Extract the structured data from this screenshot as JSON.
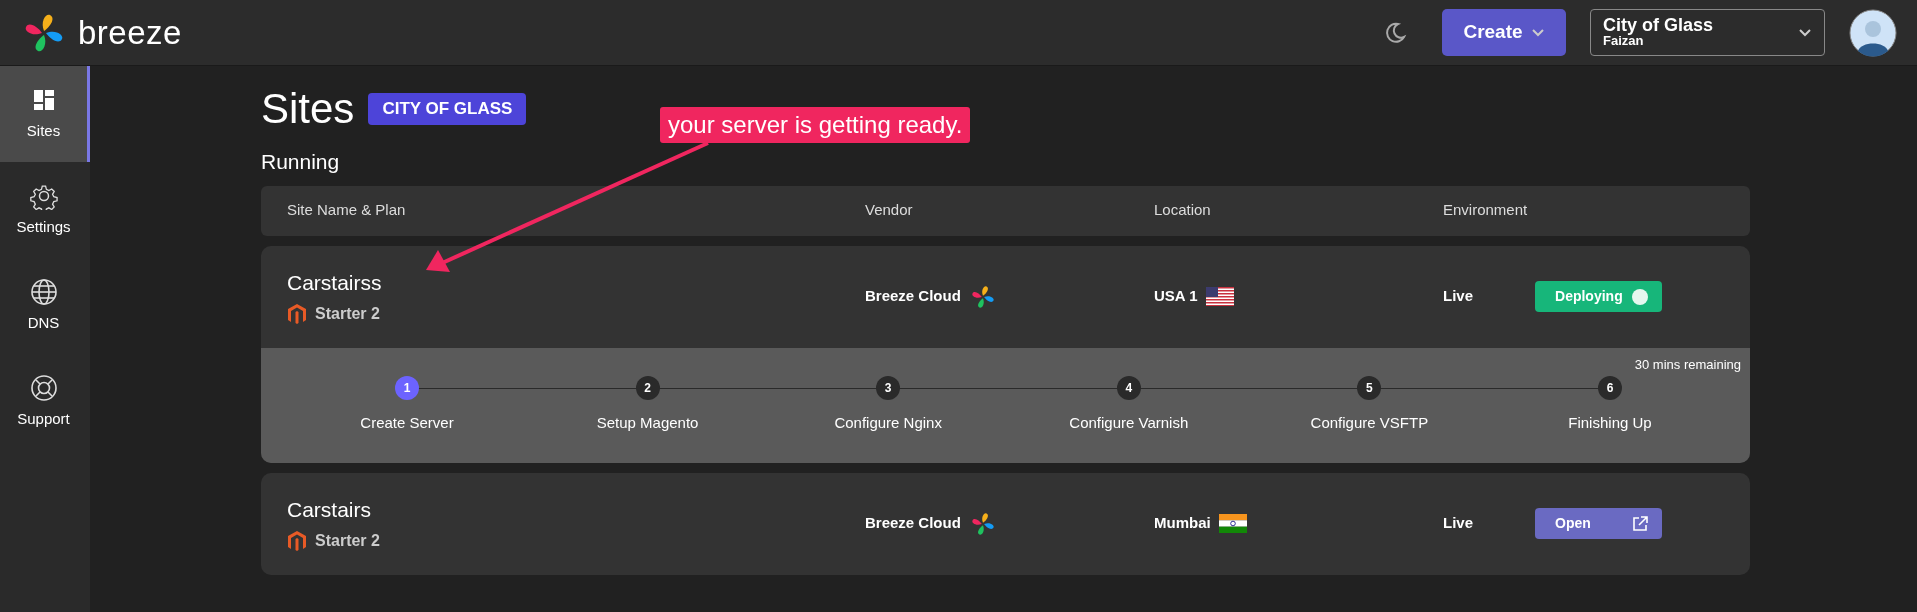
{
  "brand": {
    "name": "breeze"
  },
  "topbar": {
    "create_label": "Create",
    "org": {
      "name": "City of Glass",
      "user": "Faizan"
    }
  },
  "sidebar": {
    "items": [
      {
        "label": "Sites",
        "selected": true
      },
      {
        "label": "Settings",
        "selected": false
      },
      {
        "label": "DNS",
        "selected": false
      },
      {
        "label": "Support",
        "selected": false
      }
    ]
  },
  "page": {
    "title": "Sites",
    "badge": "CITY OF GLASS",
    "section": "Running"
  },
  "annotation": {
    "text": "your server is getting ready."
  },
  "table": {
    "columns": [
      "Site Name & Plan",
      "Vendor",
      "Location",
      "Environment"
    ],
    "rows": [
      {
        "name": "Carstairss",
        "plan": "Starter 2",
        "vendor": "Breeze Cloud",
        "location": "USA 1",
        "environment": "Live",
        "status": {
          "kind": "deploying",
          "label": "Deploying"
        },
        "progress": {
          "remaining": "30 mins remaining",
          "steps": [
            {
              "number": "1",
              "label": "Create Server",
              "active": true
            },
            {
              "number": "2",
              "label": "Setup Magento",
              "active": false
            },
            {
              "number": "3",
              "label": "Configure Nginx",
              "active": false
            },
            {
              "number": "4",
              "label": "Configure Varnish",
              "active": false
            },
            {
              "number": "5",
              "label": "Configure VSFTP",
              "active": false
            },
            {
              "number": "6",
              "label": "Finishing Up",
              "active": false
            }
          ]
        }
      },
      {
        "name": "Carstairs",
        "plan": "Starter 2",
        "vendor": "Breeze Cloud",
        "location": "Mumbai",
        "environment": "Live",
        "status": {
          "kind": "open",
          "label": "Open"
        }
      }
    ]
  }
}
